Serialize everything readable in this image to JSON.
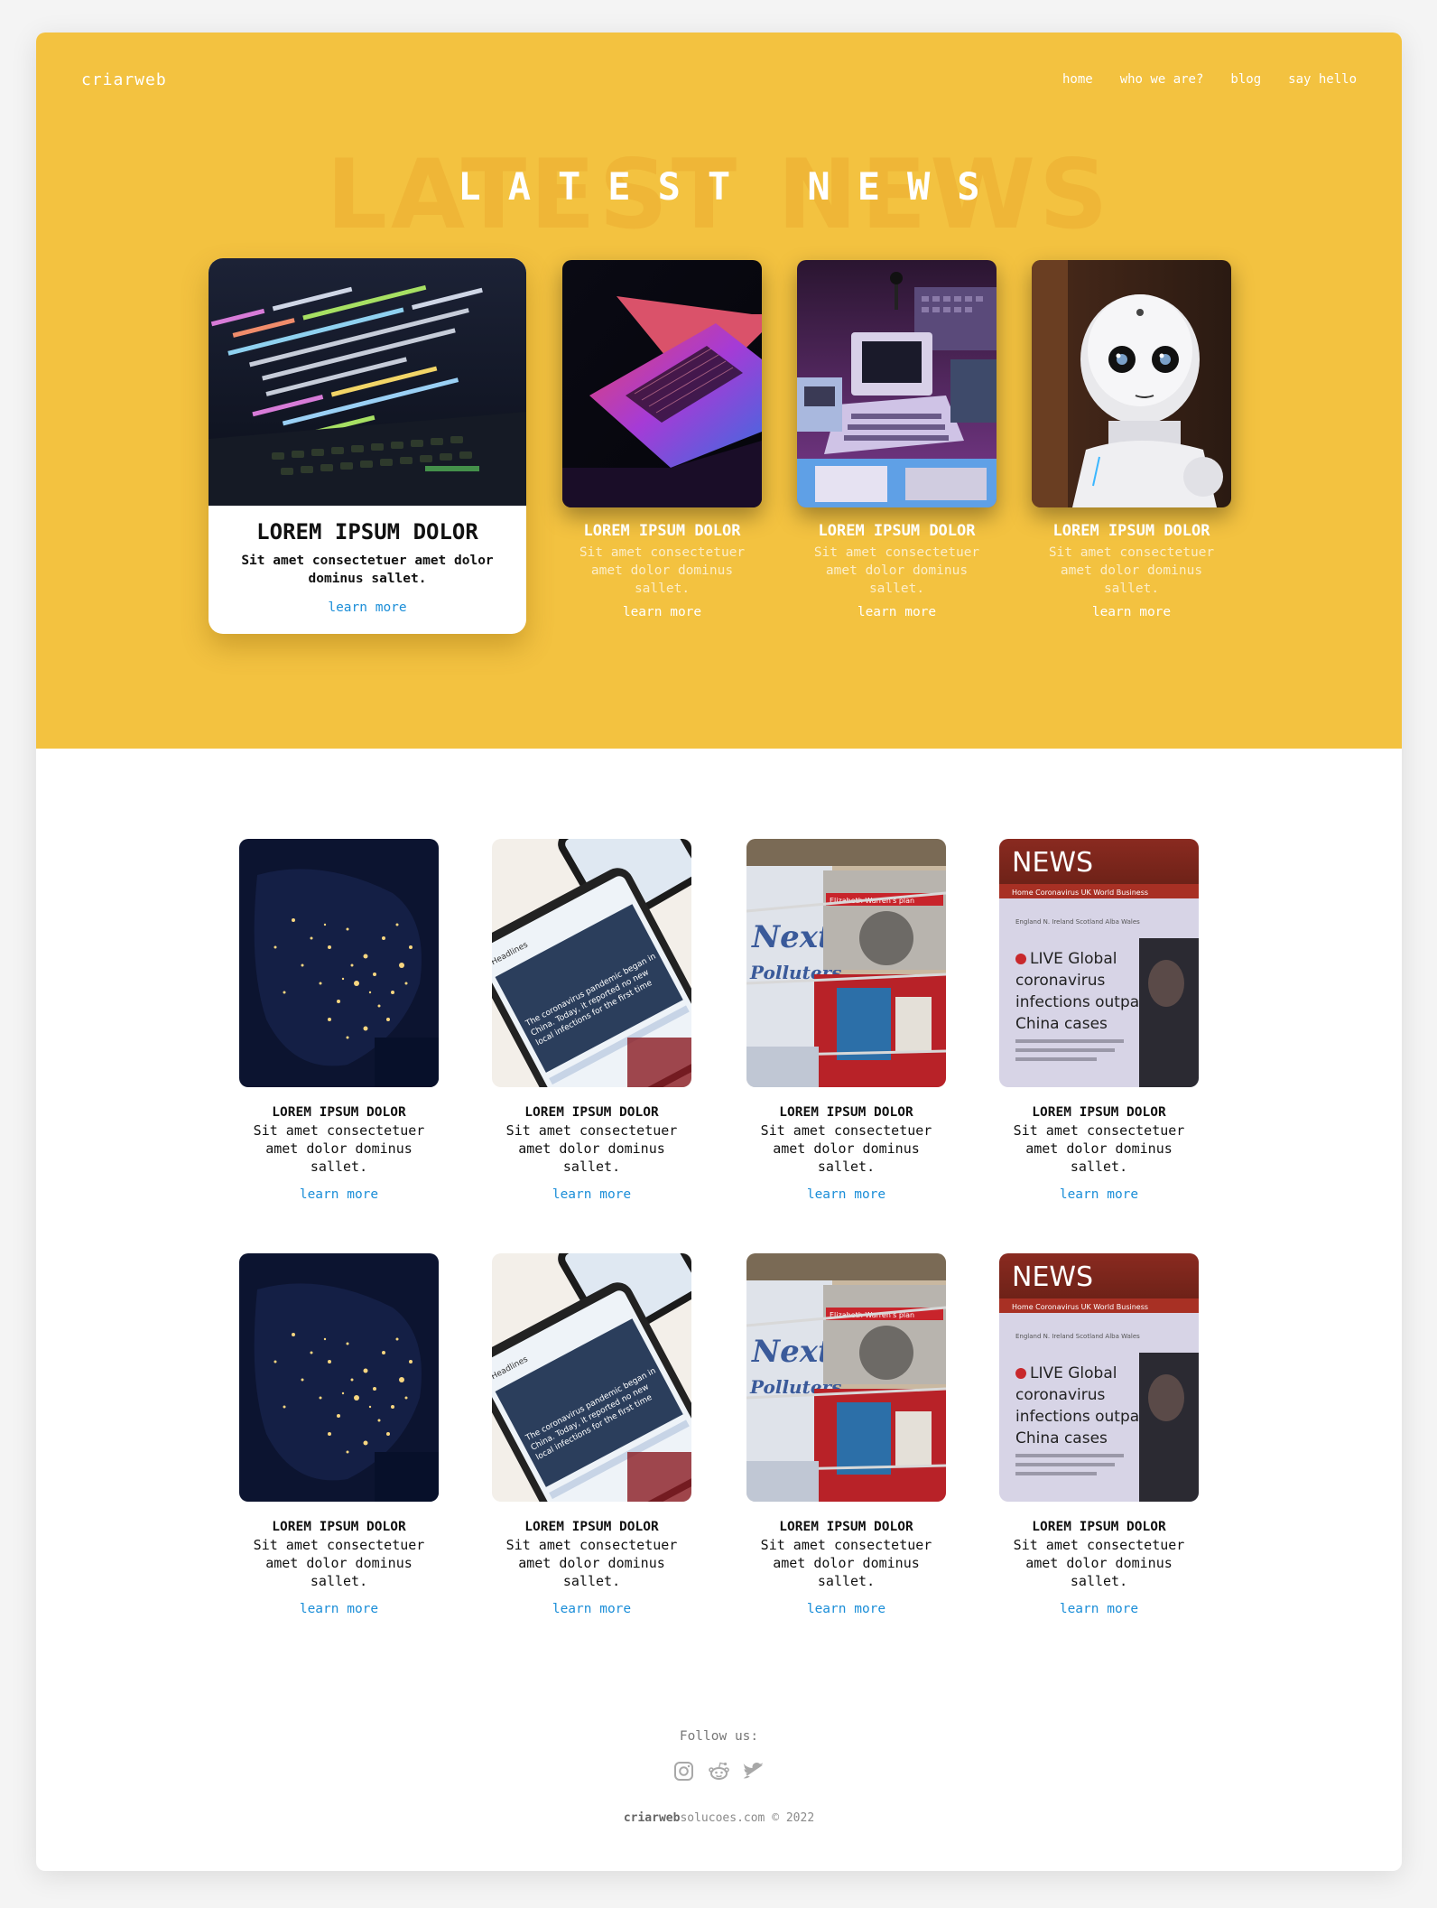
{
  "brand": "criarweb",
  "nav": [
    "home",
    "who we are?",
    "blog",
    "say hello"
  ],
  "hero": {
    "title": "LATEST NEWS",
    "featured": {
      "image": "laptop-code-image",
      "title": "LOREM IPSUM DOLOR",
      "desc": "Sit amet consectetuer amet dolor dominus sallet.",
      "link": "learn more"
    },
    "cards": [
      {
        "image": "macbook-image",
        "title": "LOREM IPSUM DOLOR",
        "desc": "Sit amet consectetuer amet dolor dominus sallet.",
        "link": "learn more"
      },
      {
        "image": "retro-computer-image",
        "title": "LOREM IPSUM DOLOR",
        "desc": "Sit amet consectetuer amet dolor dominus sallet.",
        "link": "learn more"
      },
      {
        "image": "robot-image",
        "title": "LOREM IPSUM DOLOR",
        "desc": "Sit amet consectetuer amet dolor dominus sallet.",
        "link": "learn more"
      }
    ]
  },
  "grid": {
    "rows": [
      [
        {
          "image": "earth-night-image",
          "title": "LOREM IPSUM DOLOR",
          "desc": "Sit amet consectetuer amet dolor dominus sallet.",
          "link": "learn more"
        },
        {
          "image": "phone-news-image",
          "title": "LOREM IPSUM DOLOR",
          "desc": "Sit amet consectetuer amet dolor dominus sallet.",
          "link": "learn more"
        },
        {
          "image": "magazines-image",
          "title": "LOREM IPSUM DOLOR",
          "desc": "Sit amet consectetuer amet dolor dominus sallet.",
          "link": "learn more"
        },
        {
          "image": "news-screen-image",
          "title": "LOREM IPSUM DOLOR",
          "desc": "Sit amet consectetuer amet dolor dominus sallet.",
          "link": "learn more"
        }
      ],
      [
        {
          "image": "earth-night-image",
          "title": "LOREM IPSUM DOLOR",
          "desc": "Sit amet consectetuer amet dolor dominus sallet.",
          "link": "learn more"
        },
        {
          "image": "phone-news-image",
          "title": "LOREM IPSUM DOLOR",
          "desc": "Sit amet consectetuer amet dolor dominus sallet.",
          "link": "learn more"
        },
        {
          "image": "magazines-image",
          "title": "LOREM IPSUM DOLOR",
          "desc": "Sit amet consectetuer amet dolor dominus sallet.",
          "link": "learn more"
        },
        {
          "image": "news-screen-image",
          "title": "LOREM IPSUM DOLOR",
          "desc": "Sit amet consectetuer amet dolor dominus sallet.",
          "link": "learn more"
        }
      ]
    ]
  },
  "image_text": {
    "news_word": "NEWS",
    "news_tabs": "Home   Coronavirus   UK   World   Business",
    "news_sub": "England   N. Ireland   Scotland   Alba   Wales",
    "news_headline": [
      "LIVE Global",
      "coronavirus",
      "infections outpace",
      "China cases"
    ],
    "phone_headline": "Headlines",
    "phone_story": [
      "The coronavirus pandemic began in",
      "China. Today, it reported no new",
      "local infections for the first time"
    ],
    "magazine_words": [
      "Next!",
      "Polluters"
    ],
    "magazine_tag": "Elizabeth Warren's plan"
  },
  "footer": {
    "follow": "Follow us:",
    "social": [
      "instagram-icon",
      "reddit-icon",
      "twitter-icon"
    ],
    "copyright_bold": "criarweb",
    "copyright_rest": "solucoes.com © 2022"
  },
  "colors": {
    "hero_bg": "#f3c240",
    "link_blue": "#1b8ed8",
    "white": "#ffffff"
  }
}
